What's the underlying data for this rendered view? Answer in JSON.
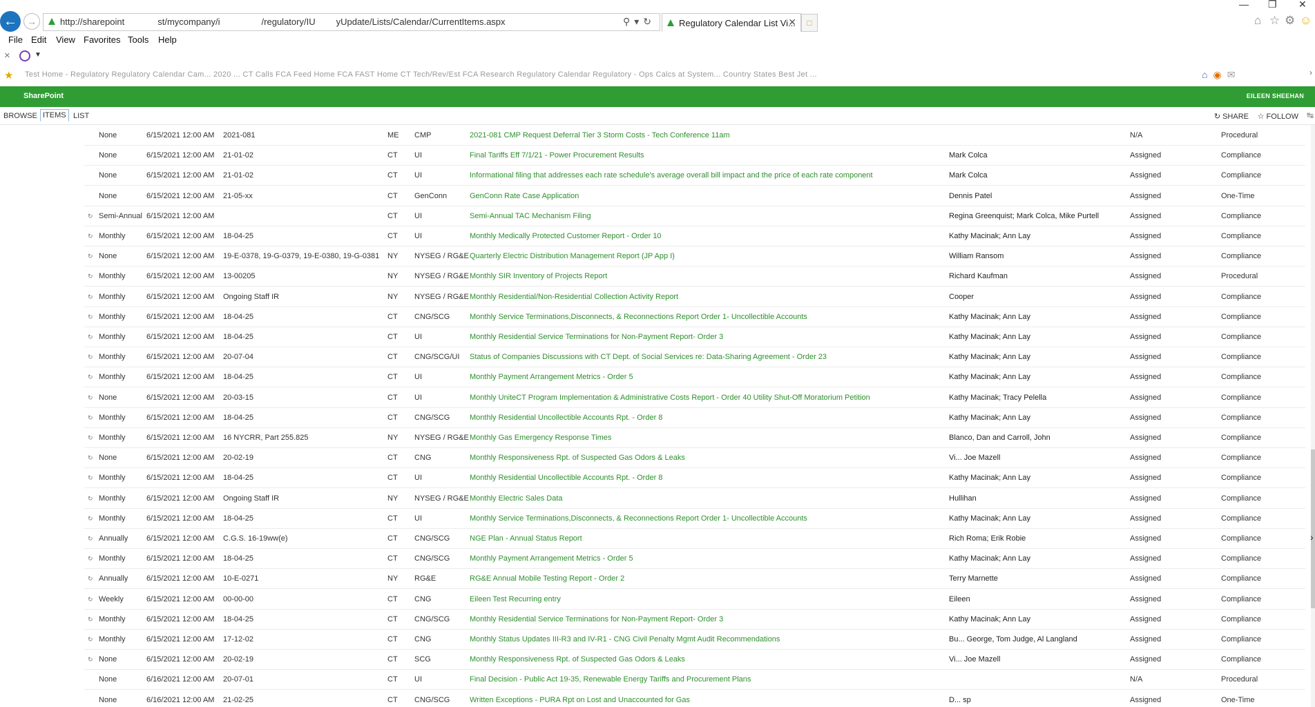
{
  "browser": {
    "url_parts": [
      "http://sharepoint",
      "st/mycompany/i",
      "/regulatory/IU",
      "yUpdate/Lists/Calendar/CurrentItems.aspx"
    ],
    "tab_title": "Regulatory Calendar List Vi...",
    "menu": [
      "File",
      "Edit",
      "View",
      "Favorites",
      "Tools",
      "Help"
    ],
    "favorites_text": "Test Home - Regulatory   Regulatory Calendar   Cam...   2020 ...   CT Calls   FCA Feed Home   FCA FAST Home   CT Tech/Rev/Est   FCA Research   Regulatory Calendar   Regulatory - Ops   Calcs at System...   Country States   Best Jet ..."
  },
  "suite": {
    "brand": "SharePoint",
    "user": "EILEEN SHEEHAN"
  },
  "ribbon": {
    "tabs": [
      "BROWSE",
      "ITEMS",
      "LIST"
    ],
    "share": "SHARE",
    "follow": "FOLLOW"
  },
  "rows": [
    {
      "recurring": false,
      "freq": "None",
      "date": "6/15/2021 12:00 AM",
      "docket": "2021-081",
      "state": "ME",
      "company": "CMP",
      "title": "2021-081 CMP Request Deferral Tier 3 Storm Costs - Tech Conference 11am",
      "people": "",
      "status": "N/A",
      "type": "Procedural"
    },
    {
      "recurring": false,
      "freq": "None",
      "date": "6/15/2021 12:00 AM",
      "docket": "21-01-02",
      "state": "CT",
      "company": "UI",
      "title": "Final Tariffs Eff 7/1/21 - Power Procurement Results",
      "people": "Mark Colca",
      "status": "Assigned",
      "type": "Compliance"
    },
    {
      "recurring": false,
      "freq": "None",
      "date": "6/15/2021 12:00 AM",
      "docket": "21-01-02",
      "state": "CT",
      "company": "UI",
      "title": "Informational filing that addresses each rate schedule's average overall bill impact and the price of each rate component",
      "people": "Mark Colca",
      "status": "Assigned",
      "type": "Compliance"
    },
    {
      "recurring": false,
      "freq": "None",
      "date": "6/15/2021 12:00 AM",
      "docket": "21-05-xx",
      "state": "CT",
      "company": "GenConn",
      "title": "GenConn Rate Case Application",
      "people": "Dennis Patel",
      "status": "Assigned",
      "type": "One-Time"
    },
    {
      "recurring": true,
      "freq": "Semi-Annual",
      "date": "6/15/2021 12:00 AM",
      "docket": "",
      "state": "CT",
      "company": "UI",
      "title": "Semi-Annual TAC Mechanism Filing",
      "people": "Regina Greenquist; Mark Colca, Mike Purtell",
      "status": "Assigned",
      "type": "Compliance"
    },
    {
      "recurring": true,
      "freq": "Monthly",
      "date": "6/15/2021 12:00 AM",
      "docket": "18-04-25",
      "state": "CT",
      "company": "UI",
      "title": "Monthly Medically Protected Customer Report - Order 10",
      "people": "Kathy Macinak; Ann Lay",
      "status": "Assigned",
      "type": "Compliance"
    },
    {
      "recurring": true,
      "freq": "None",
      "date": "6/15/2021 12:00 AM",
      "docket": "19-E-0378, 19-G-0379, 19-E-0380, 19-G-0381",
      "state": "NY",
      "company": "NYSEG / RG&E",
      "title": "Quarterly Electric Distribution Management Report (JP App I)",
      "people": "William Ransom",
      "status": "Assigned",
      "type": "Compliance"
    },
    {
      "recurring": true,
      "freq": "Monthly",
      "date": "6/15/2021 12:00 AM",
      "docket": "13-00205",
      "state": "NY",
      "company": "NYSEG / RG&E",
      "title": "Monthly SIR Inventory of Projects Report",
      "people": "Richard Kaufman",
      "status": "Assigned",
      "type": "Procedural"
    },
    {
      "recurring": true,
      "freq": "Monthly",
      "date": "6/15/2021 12:00 AM",
      "docket": "Ongoing Staff IR",
      "state": "NY",
      "company": "NYSEG / RG&E",
      "title": "Monthly Residential/Non-Residential Collection Activity Report",
      "people": "Cooper",
      "status": "Assigned",
      "type": "Compliance"
    },
    {
      "recurring": true,
      "freq": "Monthly",
      "date": "6/15/2021 12:00 AM",
      "docket": "18-04-25",
      "state": "CT",
      "company": "CNG/SCG",
      "title": "Monthly Service Terminations,Disconnects, & Reconnections Report Order 1- Uncollectible Accounts",
      "people": "Kathy Macinak; Ann Lay",
      "status": "Assigned",
      "type": "Compliance"
    },
    {
      "recurring": true,
      "freq": "Monthly",
      "date": "6/15/2021 12:00 AM",
      "docket": "18-04-25",
      "state": "CT",
      "company": "UI",
      "title": "Monthly Residential Service Terminations for Non-Payment Report- Order 3",
      "people": "Kathy Macinak; Ann Lay",
      "status": "Assigned",
      "type": "Compliance"
    },
    {
      "recurring": true,
      "freq": "Monthly",
      "date": "6/15/2021 12:00 AM",
      "docket": "20-07-04",
      "state": "CT",
      "company": "CNG/SCG/UI",
      "title": "Status of Companies Discussions with CT Dept. of Social Services re: Data-Sharing Agreement - Order 23",
      "people": "Kathy Macinak; Ann Lay",
      "status": "Assigned",
      "type": "Compliance"
    },
    {
      "recurring": true,
      "freq": "Monthly",
      "date": "6/15/2021 12:00 AM",
      "docket": "18-04-25",
      "state": "CT",
      "company": "UI",
      "title": "Monthly Payment Arrangement Metrics - Order 5",
      "people": "Kathy Macinak; Ann Lay",
      "status": "Assigned",
      "type": "Compliance"
    },
    {
      "recurring": true,
      "freq": "None",
      "date": "6/15/2021 12:00 AM",
      "docket": "20-03-15",
      "state": "CT",
      "company": "UI",
      "title": "Monthly UniteCT Program Implementation & Administrative Costs Report - Order 40 Utility Shut-Off Moratorium Petition",
      "people": "Kathy Macinak; Tracy Pelella",
      "status": "Assigned",
      "type": "Compliance"
    },
    {
      "recurring": true,
      "freq": "Monthly",
      "date": "6/15/2021 12:00 AM",
      "docket": "18-04-25",
      "state": "CT",
      "company": "CNG/SCG",
      "title": "Monthly Residential Uncollectible Accounts Rpt. - Order 8",
      "people": "Kathy Macinak; Ann Lay",
      "status": "Assigned",
      "type": "Compliance"
    },
    {
      "recurring": true,
      "freq": "Monthly",
      "date": "6/15/2021 12:00 AM",
      "docket": "16 NYCRR, Part 255.825",
      "state": "NY",
      "company": "NYSEG / RG&E",
      "title": "Monthly Gas Emergency Response Times",
      "people": "Blanco, Dan and Carroll, John",
      "status": "Assigned",
      "type": "Compliance"
    },
    {
      "recurring": true,
      "freq": "None",
      "date": "6/15/2021 12:00 AM",
      "docket": "20-02-19",
      "state": "CT",
      "company": "CNG",
      "title": "Monthly Responsiveness Rpt. of Suspected Gas Odors & Leaks",
      "people": "Vi... Joe Mazell",
      "status": "Assigned",
      "type": "Compliance"
    },
    {
      "recurring": true,
      "freq": "Monthly",
      "date": "6/15/2021 12:00 AM",
      "docket": "18-04-25",
      "state": "CT",
      "company": "UI",
      "title": "Monthly Residential Uncollectible Accounts Rpt. - Order 8",
      "people": "Kathy Macinak; Ann Lay",
      "status": "Assigned",
      "type": "Compliance"
    },
    {
      "recurring": true,
      "freq": "Monthly",
      "date": "6/15/2021 12:00 AM",
      "docket": "Ongoing Staff IR",
      "state": "NY",
      "company": "NYSEG / RG&E",
      "title": "Monthly Electric Sales Data",
      "people": "Hullihan",
      "status": "Assigned",
      "type": "Compliance"
    },
    {
      "recurring": true,
      "freq": "Monthly",
      "date": "6/15/2021 12:00 AM",
      "docket": "18-04-25",
      "state": "CT",
      "company": "UI",
      "title": "Monthly Service Terminations,Disconnects, & Reconnections Report Order 1- Uncollectible Accounts",
      "people": "Kathy Macinak; Ann Lay",
      "status": "Assigned",
      "type": "Compliance"
    },
    {
      "recurring": true,
      "freq": "Annually",
      "date": "6/15/2021 12:00 AM",
      "docket": "C.G.S. 16-19ww(e)",
      "state": "CT",
      "company": "CNG/SCG",
      "title": "NGE Plan - Annual Status Report",
      "people": "Rich Roma; Erik Robie",
      "status": "Assigned",
      "type": "Compliance"
    },
    {
      "recurring": true,
      "freq": "Monthly",
      "date": "6/15/2021 12:00 AM",
      "docket": "18-04-25",
      "state": "CT",
      "company": "CNG/SCG",
      "title": "Monthly Payment Arrangement Metrics - Order 5",
      "people": "Kathy Macinak; Ann Lay",
      "status": "Assigned",
      "type": "Compliance"
    },
    {
      "recurring": true,
      "freq": "Annually",
      "date": "6/15/2021 12:00 AM",
      "docket": "10-E-0271",
      "state": "NY",
      "company": "RG&E",
      "title": "RG&E Annual Mobile Testing Report - Order 2",
      "people": "Terry Marnette",
      "status": "Assigned",
      "type": "Compliance"
    },
    {
      "recurring": true,
      "freq": "Weekly",
      "date": "6/15/2021 12:00 AM",
      "docket": "00-00-00",
      "state": "CT",
      "company": "CNG",
      "title": "Eileen Test Recurring entry",
      "people": "Eileen",
      "status": "Assigned",
      "type": "Compliance"
    },
    {
      "recurring": true,
      "freq": "Monthly",
      "date": "6/15/2021 12:00 AM",
      "docket": "18-04-25",
      "state": "CT",
      "company": "CNG/SCG",
      "title": "Monthly Residential Service Terminations for Non-Payment Report- Order 3",
      "people": "Kathy Macinak; Ann Lay",
      "status": "Assigned",
      "type": "Compliance"
    },
    {
      "recurring": true,
      "freq": "Monthly",
      "date": "6/15/2021 12:00 AM",
      "docket": "17-12-02",
      "state": "CT",
      "company": "CNG",
      "title": "Monthly Status Updates III-R3 and IV-R1 - CNG Civil Penalty Mgmt Audit Recommendations",
      "people": "Bu... George, Tom Judge, Al Langland",
      "status": "Assigned",
      "type": "Compliance"
    },
    {
      "recurring": true,
      "freq": "None",
      "date": "6/15/2021 12:00 AM",
      "docket": "20-02-19",
      "state": "CT",
      "company": "SCG",
      "title": "Monthly Responsiveness Rpt. of Suspected Gas Odors & Leaks",
      "people": "Vi... Joe Mazell",
      "status": "Assigned",
      "type": "Compliance"
    },
    {
      "recurring": false,
      "freq": "None",
      "date": "6/16/2021 12:00 AM",
      "docket": "20-07-01",
      "state": "CT",
      "company": "UI",
      "title": "Final Decision - Public Act 19-35, Renewable Energy Tariffs and Procurement Plans",
      "people": "",
      "status": "N/A",
      "type": "Procedural"
    },
    {
      "recurring": false,
      "freq": "None",
      "date": "6/16/2021 12:00 AM",
      "docket": "21-02-25",
      "state": "CT",
      "company": "CNG/SCG",
      "title": "Written Exceptions - PURA Rpt on Lost and Unaccounted for Gas",
      "people": "D... sp",
      "status": "Assigned",
      "type": "One-Time"
    }
  ]
}
